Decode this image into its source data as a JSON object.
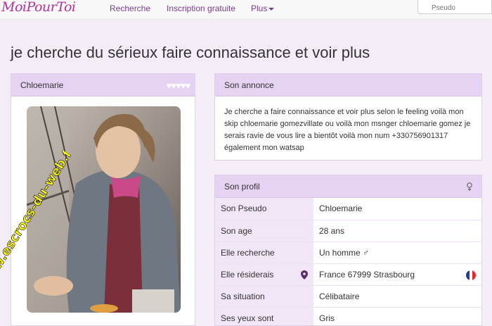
{
  "nav": {
    "brand": "MoiPourToi",
    "links": [
      "Recherche",
      "Inscription gratuite",
      "Plus"
    ],
    "search_placeholder": "Pseudo"
  },
  "page": {
    "title": "je cherche du sérieux faire connaissance et voir plus"
  },
  "profile_card": {
    "username": "Chloemarie",
    "hearts": "♥♥♥♥♥",
    "watermark": "https://www.escrocs-du-web.fr"
  },
  "annonce": {
    "heading": "Son annonce",
    "text": "Je cherche a faire connaissance et voir plus selon le feeling voilà mon skip chloemarie gomezvillate ou voilà mon msnger chloemarie gomez je serais ravie de vous lire a bientôt voilà mon num +330756901317 également mon watsap"
  },
  "profil": {
    "heading": "Son profil",
    "rows": [
      {
        "label": "Son Pseudo",
        "value": "Chloemarie"
      },
      {
        "label": "Son age",
        "value": "28 ans"
      },
      {
        "label": "Elle recherche",
        "value": "Un homme ♂"
      },
      {
        "label": "Elle résiderais",
        "value": "France 67999 Strasbourg"
      },
      {
        "label": "Sa situation",
        "value": "Célibataire"
      },
      {
        "label": "Ses yeux sont",
        "value": "Gris"
      }
    ]
  },
  "colors": {
    "brand": "#b5339a",
    "panel_heading": "#e6d2f3",
    "page_bg": "#f4ecf7",
    "watermark": "#ffff00"
  }
}
